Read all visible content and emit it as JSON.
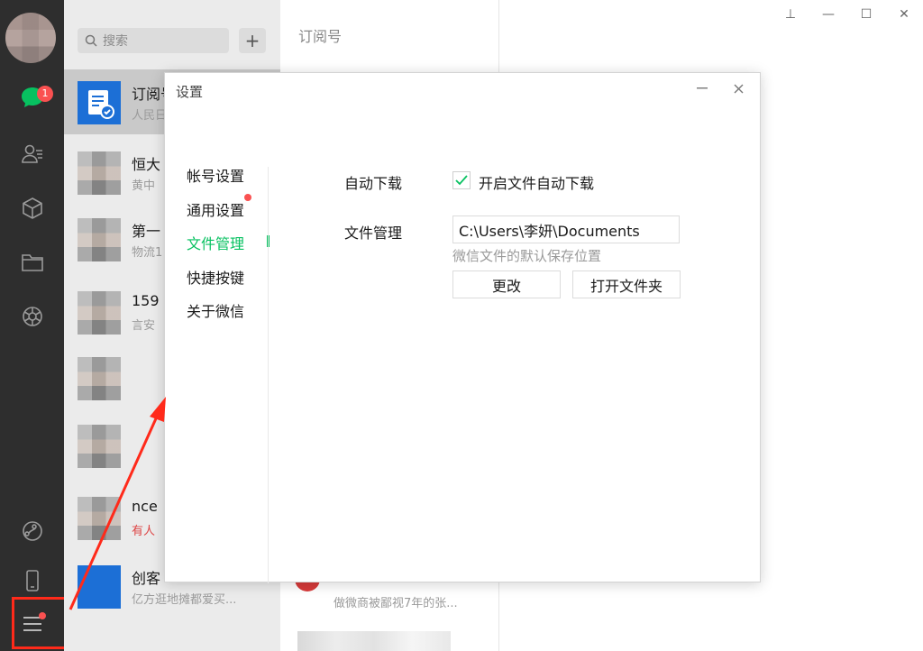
{
  "sidebar": {
    "chat_badge": "1"
  },
  "chatlist": {
    "search_placeholder": "搜索",
    "add_label": "+",
    "rows": [
      {
        "name": "订阅号",
        "sub": "人民日"
      },
      {
        "name": "恒大",
        "sub": "黄中"
      },
      {
        "name": "第一",
        "sub": "物流1"
      },
      {
        "name": "159",
        "sub": "言安"
      },
      {
        "name": "",
        "sub": ""
      },
      {
        "name": "",
        "sub": ""
      },
      {
        "name": "nce",
        "sub": "有人"
      },
      {
        "name": "创客",
        "sub": "亿方逛地摊都爱买..."
      }
    ]
  },
  "middle": {
    "title": "订阅号",
    "bottom_sub": "做微商被鄙视7年的张..."
  },
  "window_controls": {
    "pin": "⊥",
    "min": "—",
    "max": "☐",
    "close": "✕"
  },
  "dialog": {
    "title": "设置",
    "nav": [
      {
        "label": "帐号设置"
      },
      {
        "label": "通用设置"
      },
      {
        "label": "文件管理"
      },
      {
        "label": "快捷按键"
      },
      {
        "label": "关于微信"
      }
    ],
    "auto_download_label": "自动下载",
    "auto_download_option": "开启文件自动下载",
    "file_mgmt_label": "文件管理",
    "path_value": "C:\\Users\\李妍\\Documents",
    "path_hint": "微信文件的默认保存位置",
    "change_button": "更改",
    "open_folder_button": "打开文件夹"
  },
  "colors": {
    "accent": "#07c160",
    "badge": "#fa5151",
    "annotation": "#ff2a1a"
  }
}
